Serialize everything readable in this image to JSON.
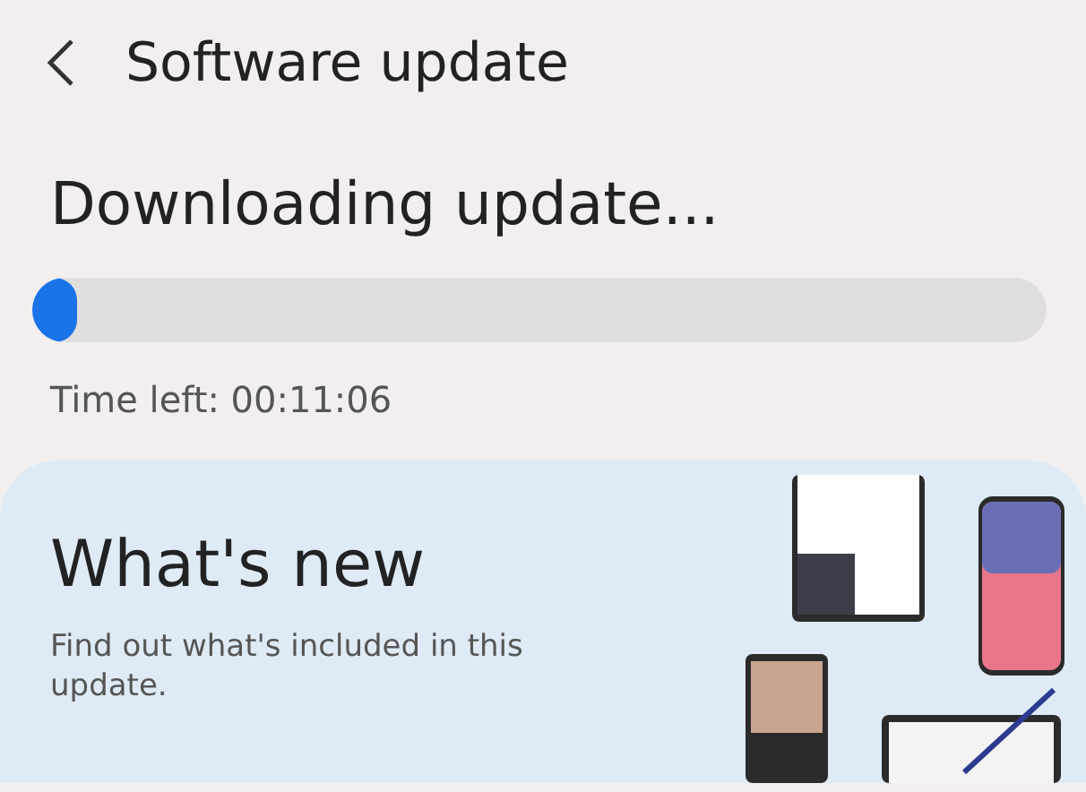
{
  "header": {
    "title": "Software update"
  },
  "status": {
    "heading": "Downloading update...",
    "progress": {
      "level": 0.012
    },
    "time_left": "Time left: 00:11:06"
  },
  "whats_new": {
    "title": "What's new",
    "description": "Find out what's included in this update."
  }
}
